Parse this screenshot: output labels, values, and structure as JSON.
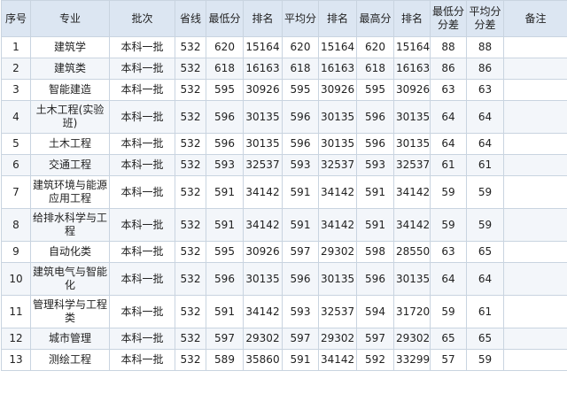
{
  "headers": [
    "序号",
    "专业",
    "批次",
    "省线",
    "最低分",
    "排名",
    "平均分",
    "排名",
    "最高分",
    "排名",
    "最低分\n分差",
    "平均分\n分差",
    "备注"
  ],
  "rows": [
    {
      "seq": "1",
      "major": "建筑学",
      "batch": "本科一批",
      "line": "532",
      "min": "620",
      "min_rank": "15164",
      "avg": "620",
      "avg_rank": "15164",
      "max": "620",
      "max_rank": "15164",
      "min_diff": "88",
      "avg_diff": "88",
      "note": "",
      "tall": false
    },
    {
      "seq": "2",
      "major": "建筑类",
      "batch": "本科一批",
      "line": "532",
      "min": "618",
      "min_rank": "16163",
      "avg": "618",
      "avg_rank": "16163",
      "max": "618",
      "max_rank": "16163",
      "min_diff": "86",
      "avg_diff": "86",
      "note": "",
      "tall": false
    },
    {
      "seq": "3",
      "major": "智能建造",
      "batch": "本科一批",
      "line": "532",
      "min": "595",
      "min_rank": "30926",
      "avg": "595",
      "avg_rank": "30926",
      "max": "595",
      "max_rank": "30926",
      "min_diff": "63",
      "avg_diff": "63",
      "note": "",
      "tall": false
    },
    {
      "seq": "4",
      "major": "土木工程(实验班)",
      "batch": "本科一批",
      "line": "532",
      "min": "596",
      "min_rank": "30135",
      "avg": "596",
      "avg_rank": "30135",
      "max": "596",
      "max_rank": "30135",
      "min_diff": "64",
      "avg_diff": "64",
      "note": "",
      "tall": true
    },
    {
      "seq": "5",
      "major": "土木工程",
      "batch": "本科一批",
      "line": "532",
      "min": "596",
      "min_rank": "30135",
      "avg": "596",
      "avg_rank": "30135",
      "max": "596",
      "max_rank": "30135",
      "min_diff": "64",
      "avg_diff": "64",
      "note": "",
      "tall": false
    },
    {
      "seq": "6",
      "major": "交通工程",
      "batch": "本科一批",
      "line": "532",
      "min": "593",
      "min_rank": "32537",
      "avg": "593",
      "avg_rank": "32537",
      "max": "593",
      "max_rank": "32537",
      "min_diff": "61",
      "avg_diff": "61",
      "note": "",
      "tall": false
    },
    {
      "seq": "7",
      "major": "建筑环境与能源应用工程",
      "batch": "本科一批",
      "line": "532",
      "min": "591",
      "min_rank": "34142",
      "avg": "591",
      "avg_rank": "34142",
      "max": "591",
      "max_rank": "34142",
      "min_diff": "59",
      "avg_diff": "59",
      "note": "",
      "tall": true
    },
    {
      "seq": "8",
      "major": "给排水科学与工程",
      "batch": "本科一批",
      "line": "532",
      "min": "591",
      "min_rank": "34142",
      "avg": "591",
      "avg_rank": "34142",
      "max": "591",
      "max_rank": "34142",
      "min_diff": "59",
      "avg_diff": "59",
      "note": "",
      "tall": true
    },
    {
      "seq": "9",
      "major": "自动化类",
      "batch": "本科一批",
      "line": "532",
      "min": "595",
      "min_rank": "30926",
      "avg": "597",
      "avg_rank": "29302",
      "max": "598",
      "max_rank": "28550",
      "min_diff": "63",
      "avg_diff": "65",
      "note": "",
      "tall": false
    },
    {
      "seq": "10",
      "major": "建筑电气与智能化",
      "batch": "本科一批",
      "line": "532",
      "min": "596",
      "min_rank": "30135",
      "avg": "596",
      "avg_rank": "30135",
      "max": "596",
      "max_rank": "30135",
      "min_diff": "64",
      "avg_diff": "64",
      "note": "",
      "tall": true
    },
    {
      "seq": "11",
      "major": "管理科学与工程类",
      "batch": "本科一批",
      "line": "532",
      "min": "591",
      "min_rank": "34142",
      "avg": "593",
      "avg_rank": "32537",
      "max": "594",
      "max_rank": "31720",
      "min_diff": "59",
      "avg_diff": "61",
      "note": "",
      "tall": true
    },
    {
      "seq": "12",
      "major": "城市管理",
      "batch": "本科一批",
      "line": "532",
      "min": "597",
      "min_rank": "29302",
      "avg": "597",
      "avg_rank": "29302",
      "max": "597",
      "max_rank": "29302",
      "min_diff": "65",
      "avg_diff": "65",
      "note": "",
      "tall": false
    },
    {
      "seq": "13",
      "major": "测绘工程",
      "batch": "本科一批",
      "line": "532",
      "min": "589",
      "min_rank": "35860",
      "avg": "591",
      "avg_rank": "34142",
      "max": "592",
      "max_rank": "33299",
      "min_diff": "57",
      "avg_diff": "59",
      "note": "",
      "tall": false
    }
  ]
}
